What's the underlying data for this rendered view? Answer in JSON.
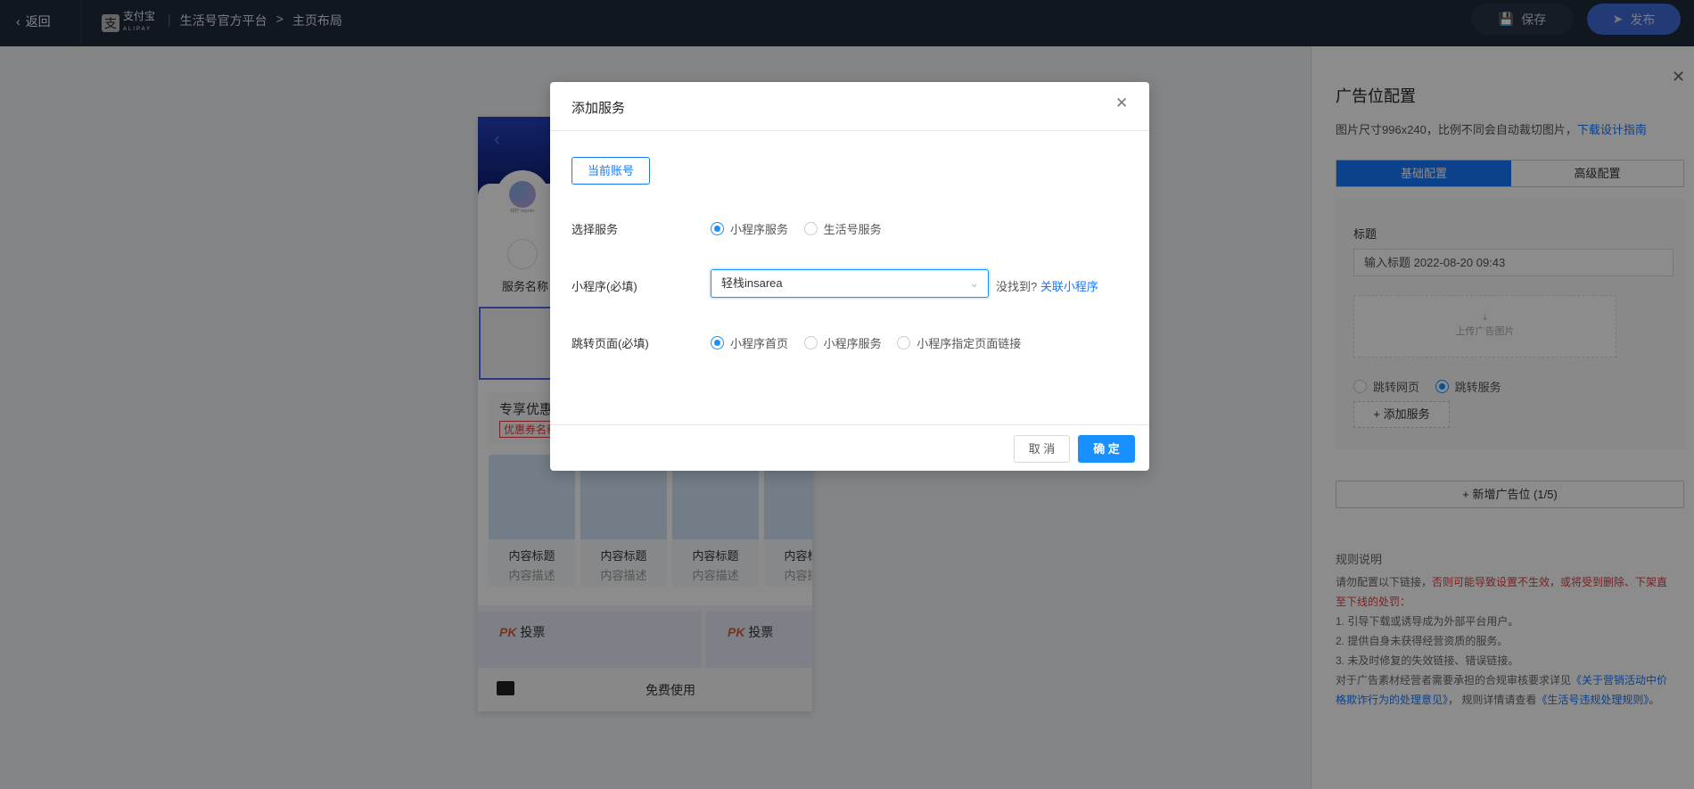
{
  "topbar": {
    "back": "返回",
    "logo_text": "支付宝",
    "logo_sub": "ALIPAY",
    "platform": "生活号官方平台",
    "page": "主页布局",
    "save": "保存",
    "publish": "发布"
  },
  "phone": {
    "service_name": "服务名称",
    "logo_caption": "绿柠 nspnks",
    "coupon_title": "专享优惠",
    "coupon_tag": "优惠券名称",
    "cards": [
      {
        "title": "内容标题",
        "desc": "内容描述"
      },
      {
        "title": "内容标题",
        "desc": "内容描述"
      },
      {
        "title": "内容标题",
        "desc": "内容描述"
      },
      {
        "title": "内容标题",
        "desc": "内容描述"
      }
    ],
    "votes": [
      {
        "badge": "PK",
        "label": "投票"
      },
      {
        "badge": "PK",
        "label": "投票"
      }
    ],
    "bottom_action": "免费使用"
  },
  "panel": {
    "title": "广告位配置",
    "desc": "图片尺寸996x240，比例不同会自动裁切图片，",
    "desc_link": "下载设计指南",
    "tabs": [
      {
        "label": "基础配置",
        "active": true
      },
      {
        "label": "高级配置",
        "active": false
      }
    ],
    "field_label": "标题",
    "field_value": "输入标题 2022-08-20 09:43",
    "upload": "上传广告图片",
    "jump": [
      {
        "label": "跳转网页",
        "checked": false
      },
      {
        "label": "跳转服务",
        "checked": true
      }
    ],
    "add_service": "添加服务",
    "new_slot": "新增广告位 (1/5)",
    "rules": {
      "title": "规则说明",
      "intro": "请勿配置以下链接，",
      "warn": "否则可能导致设置不生效，或将受到删除、下架直至下线的处罚：",
      "items": [
        "1. 引导下载或诱导成为外部平台用户。",
        "2. 提供自身未获得经营资质的服务。",
        "3. 未及时修复的失效链接、错误链接。"
      ],
      "tail1": "对于广告素材经营者需要承担的合规审核要求详见",
      "link1": "《关于营销活动中价格欺诈行为的处理意见》",
      "tail2": "， 规则详情请查看",
      "link2": "《生活号违规处理规则》",
      "tail3": "。"
    }
  },
  "dialog": {
    "title": "添加服务",
    "account_button": "当前账号",
    "service_label": "选择服务",
    "service_options": [
      {
        "label": "小程序服务",
        "checked": true
      },
      {
        "label": "生活号服务",
        "checked": false
      }
    ],
    "miniapp_label": "小程序(必填)",
    "miniapp_value": "轻栈insarea",
    "not_found": "没找到?",
    "link_miniapp": "关联小程序",
    "jump_label": "跳转页面(必填)",
    "jump_options": [
      {
        "label": "小程序首页",
        "checked": true
      },
      {
        "label": "小程序服务",
        "checked": false
      },
      {
        "label": "小程序指定页面链接",
        "checked": false
      }
    ],
    "cancel": "取 消",
    "confirm": "确 定"
  },
  "colors": {
    "primary": "#1890ff",
    "danger": "#e4393c",
    "topbar": "#1f2a3a"
  }
}
